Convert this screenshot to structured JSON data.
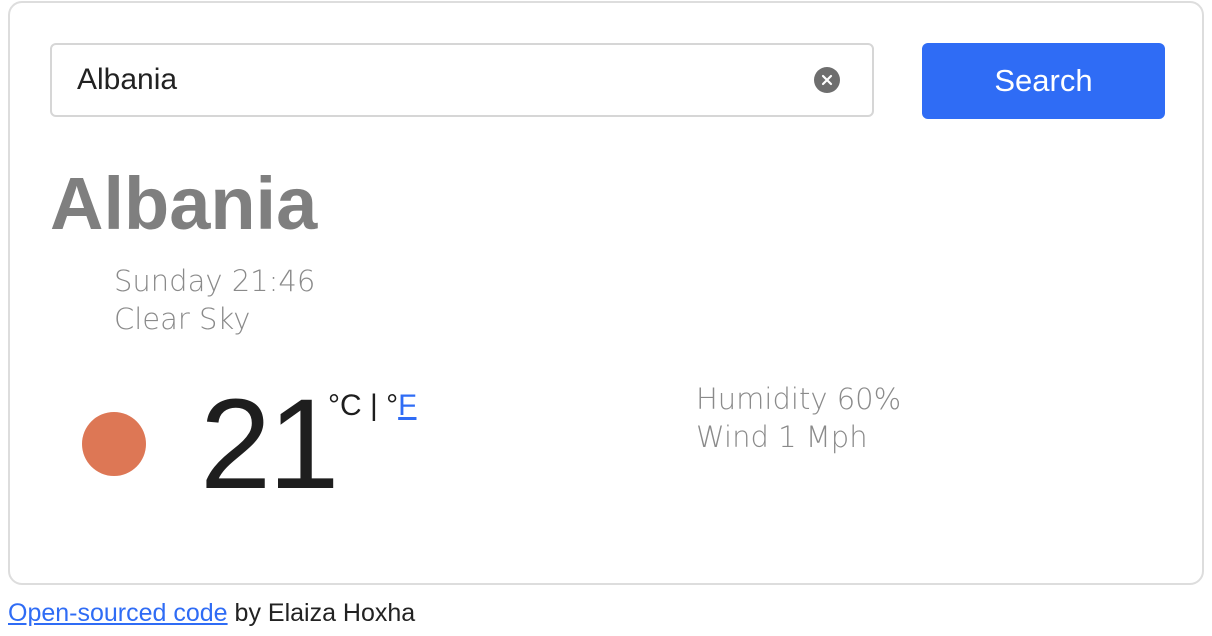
{
  "search": {
    "value": "Albania",
    "placeholder": "",
    "clear_icon": "clear-circle-icon",
    "button_label": "Search"
  },
  "weather": {
    "city": "Albania",
    "day_time": "Sunday 21:46",
    "description": "Clear Sky",
    "icon": "sun-icon",
    "temperature": "21",
    "unit_celsius": "°C",
    "unit_separator": "|",
    "unit_degree": "°",
    "unit_fahrenheit": "F",
    "humidity": "Humidity 60%",
    "wind": "Wind 1 Mph"
  },
  "footer": {
    "link_text": "Open-sourced code",
    "suffix": " by Elaiza Hoxha"
  },
  "colors": {
    "accent": "#2f6cf5",
    "sun": "#dd7755",
    "muted_text": "#8a8a8a"
  }
}
